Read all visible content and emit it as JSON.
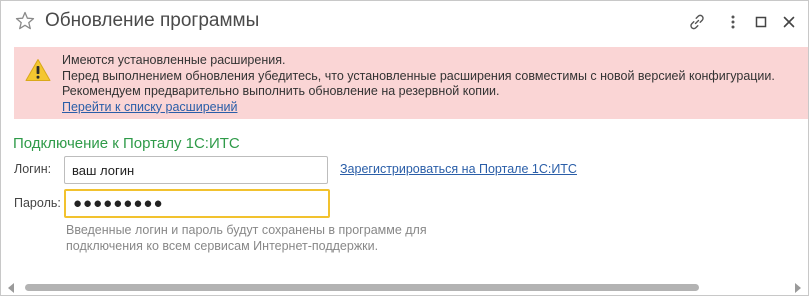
{
  "window": {
    "title": "Обновление программы",
    "icons": {
      "favorite": "star-icon",
      "link": "link-icon",
      "menu": "more-vertical-icon",
      "maximize": "maximize-icon",
      "close": "close-icon"
    }
  },
  "banner": {
    "icon": "warning-icon",
    "line1": "Имеются установленные расширения.",
    "line2": "Перед выполнением обновления убедитесь, что установленные расширения совместимы с новой версией конфигурации.",
    "line3": "Рекомендуем предварительно выполнить обновление на резервной копии.",
    "link": "Перейти к списку расширений",
    "background_color": "#fad5d5"
  },
  "connection": {
    "section_title": "Подключение к Порталу 1С:ИТС",
    "login_label": "Логин:",
    "login_value": "ваш логин",
    "password_label": "Пароль:",
    "password_value": "●●●●●●●●●",
    "register_link": "Зарегистрироваться на Портале 1С:ИТС",
    "hint_line1": "Введенные логин и пароль будут сохранены в программе для",
    "hint_line2": "подключения ко всем сервисам Интернет-поддержки.",
    "accent_color": "#2f9b49",
    "focus_color": "#f2c22e"
  }
}
